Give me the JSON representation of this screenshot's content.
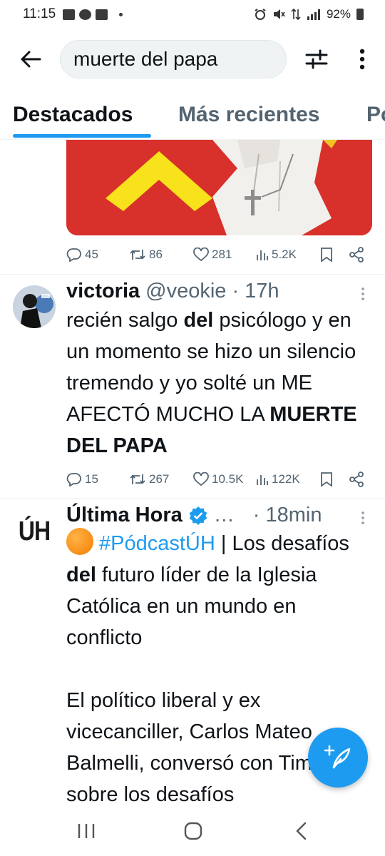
{
  "status_bar": {
    "time": "11:15",
    "battery": "92%"
  },
  "search": {
    "query": "muerte del papa"
  },
  "tabs": [
    {
      "label": "Destacados",
      "active": true
    },
    {
      "label": "Más recientes",
      "active": false
    },
    {
      "label": "Po",
      "active": false
    }
  ],
  "tweet0": {
    "replies": "45",
    "retweets": "86",
    "likes": "281",
    "views": "5.2K"
  },
  "tweet1": {
    "name": "victoria",
    "handle": "@veokie",
    "time": "· 17h",
    "text_parts": [
      "recién salgo ",
      "del",
      " psicólogo y en un momento se hizo un silencio tremendo y yo solté un ME AFECTÓ MUCHO LA ",
      "MUERTE DEL PAPA"
    ],
    "replies": "15",
    "retweets": "267",
    "likes": "10.5K",
    "views": "122K"
  },
  "tweet2": {
    "name": "Última Hora",
    "ellipsis": "…",
    "time": "· 18min",
    "avatar_text": "ÚH",
    "hashtag": "#PódcastÚH",
    "text_a": " | Los desafíos ",
    "text_b": "del",
    "text_c": " futuro líder de la Iglesia Católica en un mundo en conflicto",
    "text_d": "El político liberal y ex vicecanciller, Carlos Mateo Balmelli, conversó con Timore sobre los desafíos"
  },
  "colors": {
    "accent": "#1d9bf0",
    "text": "#0f1419",
    "muted": "#536471"
  }
}
